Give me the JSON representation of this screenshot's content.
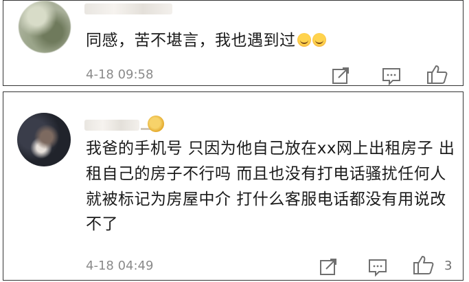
{
  "comments": [
    {
      "text": "同感，苦不堪言，我也遇到过",
      "emojis": [
        "crying-face-emoji",
        "crying-face-emoji"
      ],
      "time": "4-18 09:58",
      "likes": ""
    },
    {
      "text": "我爸的手机号 只因为他自己放在xx网上出租房子 出租自己的房子不行吗 而且也没有打电话骚扰任何人 就被标记为房屋中介 打什么客服电话都没有用说改不了",
      "time": "4-18 04:49",
      "likes": "3"
    }
  ],
  "icons": {
    "share": "share-icon",
    "comment": "comment-icon",
    "like": "like-icon"
  },
  "colors": {
    "text": "#1a1a1a",
    "meta": "#8a8a8a",
    "icon": "#6f6f6f",
    "border": "#333333"
  }
}
